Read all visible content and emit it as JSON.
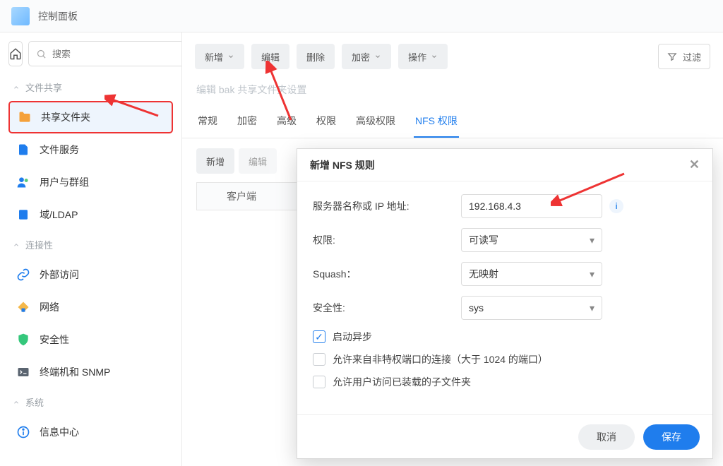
{
  "app": {
    "title": "控制面板"
  },
  "sidebar": {
    "search_placeholder": "搜索",
    "sections": {
      "file_share_label": "文件共享",
      "connectivity_label": "连接性",
      "system_label": "系统"
    },
    "items": {
      "shared_folder": "共享文件夹",
      "file_service": "文件服务",
      "user_group": "用户与群组",
      "domain_ldap": "域/LDAP",
      "external_access": "外部访问",
      "network": "网络",
      "security": "安全性",
      "terminal_snmp": "终端机和 SNMP",
      "info_center": "信息中心"
    }
  },
  "toolbar": {
    "new": "新增",
    "edit": "编辑",
    "delete": "删除",
    "encrypt": "加密",
    "operate": "操作",
    "filter_label": "过滤"
  },
  "page": {
    "edit_title": "编辑 bak 共享文件夹设置"
  },
  "tabs": {
    "general": "常规",
    "encryption": "加密",
    "advanced": "高级",
    "permission": "权限",
    "advanced_permission": "高级权限",
    "nfs_permission": "NFS 权限"
  },
  "subbar": {
    "new": "新增",
    "edit": "编辑"
  },
  "table": {
    "client_col": "客户端"
  },
  "modal": {
    "title": "新增 NFS 规则",
    "fields": {
      "host_label": "服务器名称或 IP 地址:",
      "host_value": "192.168.4.3",
      "privilege_label": "权限:",
      "privilege_value": "可读写",
      "squash_label": "Squash：",
      "squash_value": "无映射",
      "security_label": "安全性:",
      "security_value": "sys"
    },
    "checks": {
      "async": "启动异步",
      "nonpriv_port": "允许来自非特权端口的连接（大于 1024 的端口）",
      "mounted_sub": "允许用户访问已装载的子文件夹"
    },
    "buttons": {
      "cancel": "取消",
      "save": "保存"
    }
  }
}
